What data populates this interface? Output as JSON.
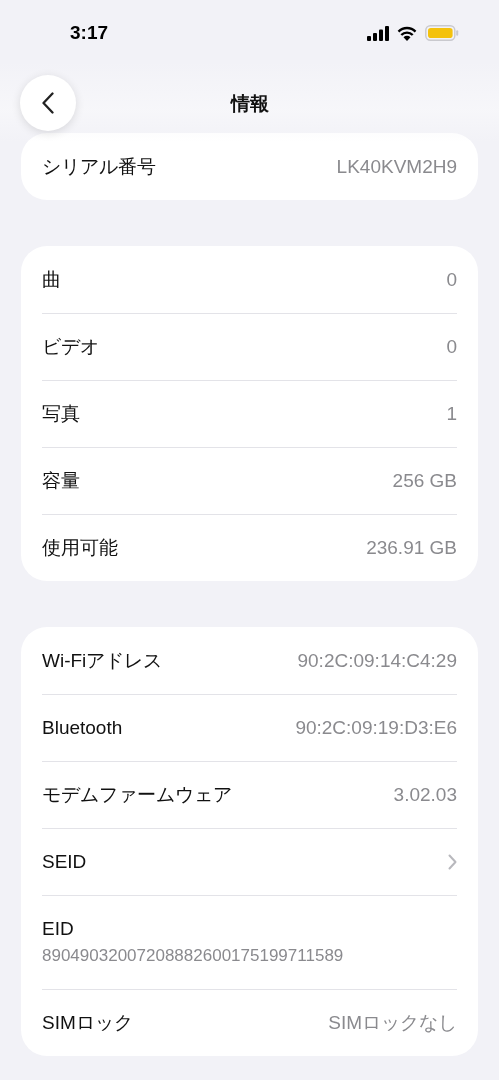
{
  "status_bar": {
    "time": "3:17"
  },
  "nav": {
    "title": "情報"
  },
  "sections": [
    {
      "rows": [
        {
          "kind": "value",
          "label": "シリアル番号",
          "value": "LK40KVM2H9"
        }
      ]
    },
    {
      "rows": [
        {
          "kind": "value",
          "label": "曲",
          "value": "0"
        },
        {
          "kind": "value",
          "label": "ビデオ",
          "value": "0"
        },
        {
          "kind": "value",
          "label": "写真",
          "value": "1"
        },
        {
          "kind": "value",
          "label": "容量",
          "value": "256 GB"
        },
        {
          "kind": "value",
          "label": "使用可能",
          "value": "236.91 GB"
        }
      ]
    },
    {
      "rows": [
        {
          "kind": "value",
          "label": "Wi-Fiアドレス",
          "value": "90:2C:09:14:C4:29"
        },
        {
          "kind": "value",
          "label": "Bluetooth",
          "value": "90:2C:09:19:D3:E6"
        },
        {
          "kind": "value",
          "label": "モデムファームウェア",
          "value": "3.02.03"
        },
        {
          "kind": "link",
          "label": "SEID"
        },
        {
          "kind": "stacked",
          "label": "EID",
          "value": "89049032007208882600175199711589"
        },
        {
          "kind": "value",
          "label": "SIMロック",
          "value": "SIMロックなし"
        }
      ]
    }
  ]
}
